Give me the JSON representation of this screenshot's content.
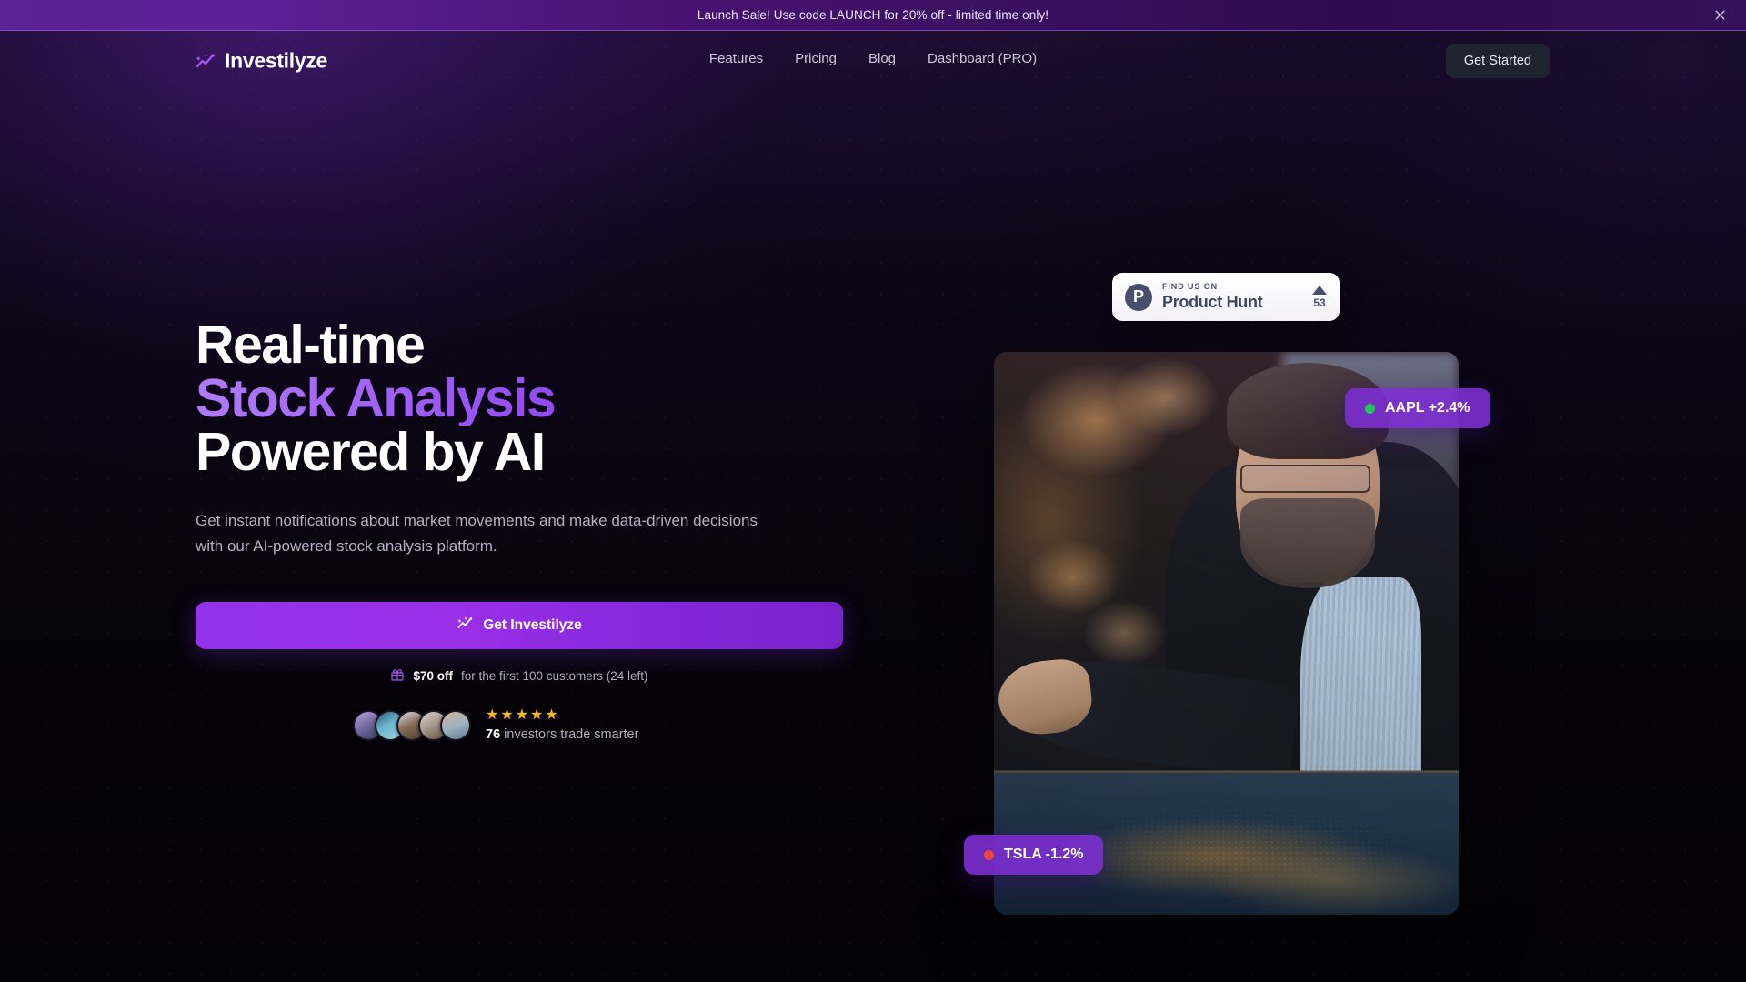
{
  "banner": {
    "text": "Launch Sale! Use code LAUNCH for 20% off - limited time only!",
    "close_icon": "close-icon"
  },
  "header": {
    "brand": "Investilyze",
    "logo_icon": "sparkle-chart-icon",
    "nav": [
      {
        "label": "Features"
      },
      {
        "label": "Pricing"
      },
      {
        "label": "Blog"
      },
      {
        "label": "Dashboard (PRO)"
      }
    ],
    "cta_label": "Get Started"
  },
  "hero": {
    "headline_line1": "Real-time",
    "headline_line2": "Stock Analysis",
    "headline_line3": "Powered by AI",
    "subhead": "Get instant notifications about market movements and make data-driven decisions with our AI-powered stock analysis platform.",
    "cta_label": "Get Investilyze",
    "cta_icon": "sparkle-chart-icon",
    "discount_icon": "gift-icon",
    "discount_amount": "$70 off",
    "discount_rest": " for the first 100 customers (24 left)",
    "stars": "★★★★★",
    "proof_count": "76",
    "proof_rest": " investors trade smarter",
    "avatar_count": 5
  },
  "product_hunt": {
    "icon": "product-hunt-p-icon",
    "eyebrow": "FIND US ON",
    "name": "Product Hunt",
    "upvote_icon": "upvote-triangle-icon",
    "upvote_count": "53"
  },
  "tickers": [
    {
      "symbol_change": "AAPL +2.4%",
      "dot_color": "#22c55e",
      "direction": "up"
    },
    {
      "symbol_change": "TSLA -1.2%",
      "dot_color": "#ef4444",
      "direction": "down"
    }
  ],
  "hero_image": {
    "alt": "analyst-pointing-at-digital-map-table"
  },
  "colors": {
    "accent_purple": "#9333ea",
    "accent_purple_light": "#a855f7",
    "banner_purple": "#5b2393",
    "positive_green": "#22c55e",
    "negative_red": "#ef4444",
    "star_gold": "#f5b91c",
    "page_bg": "#060409"
  }
}
